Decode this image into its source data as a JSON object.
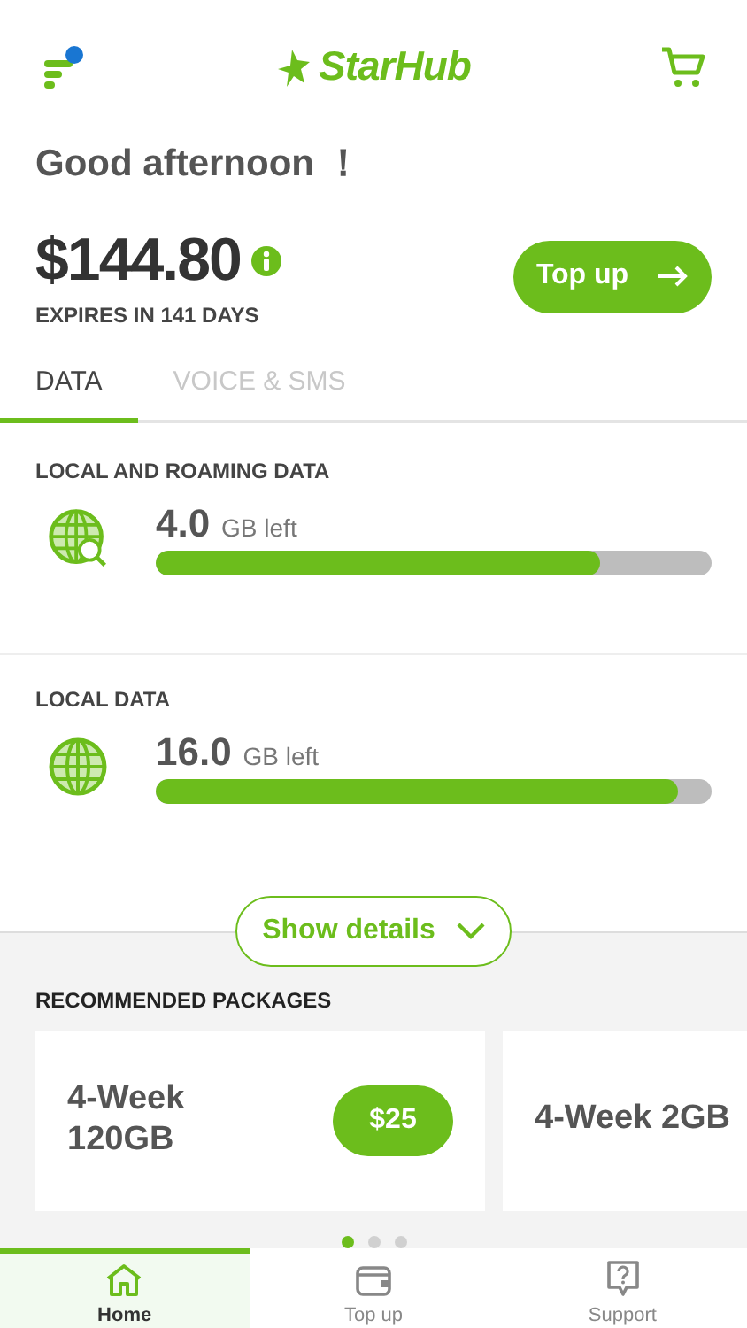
{
  "header": {
    "brand": "StarHub"
  },
  "greeting": "Good afternoon ！",
  "balance": {
    "amount": "$144.80",
    "expiry": "EXPIRES IN 141 DAYS",
    "action": "Top up"
  },
  "tabs": [
    {
      "label": "DATA",
      "selected": true
    },
    {
      "label": "VOICE & SMS",
      "selected": false
    }
  ],
  "data_plans": [
    {
      "title": "LOCAL AND ROAMING DATA",
      "kind": "roaming",
      "amount": "4.0",
      "unit": "GB left",
      "level": 0.8
    },
    {
      "title": "LOCAL DATA",
      "kind": "local",
      "amount": "16.0",
      "unit": "GB left",
      "level": 0.94
    }
  ],
  "details_button": "Show details",
  "packages": {
    "title": "RECOMMENDED PACKAGES",
    "items": [
      {
        "name": "4-Week 120GB",
        "price": "$25"
      },
      {
        "name": "4-Week 2GB"
      }
    ],
    "pages": [
      {
        "selected": true
      },
      {
        "selected": false
      },
      {
        "selected": false
      }
    ]
  },
  "bottom_nav": [
    {
      "label": "Home",
      "kind": "home",
      "selected": true
    },
    {
      "label": "Top up",
      "kind": "wallet",
      "selected": false
    },
    {
      "label": "Support",
      "kind": "support",
      "selected": false
    }
  ]
}
